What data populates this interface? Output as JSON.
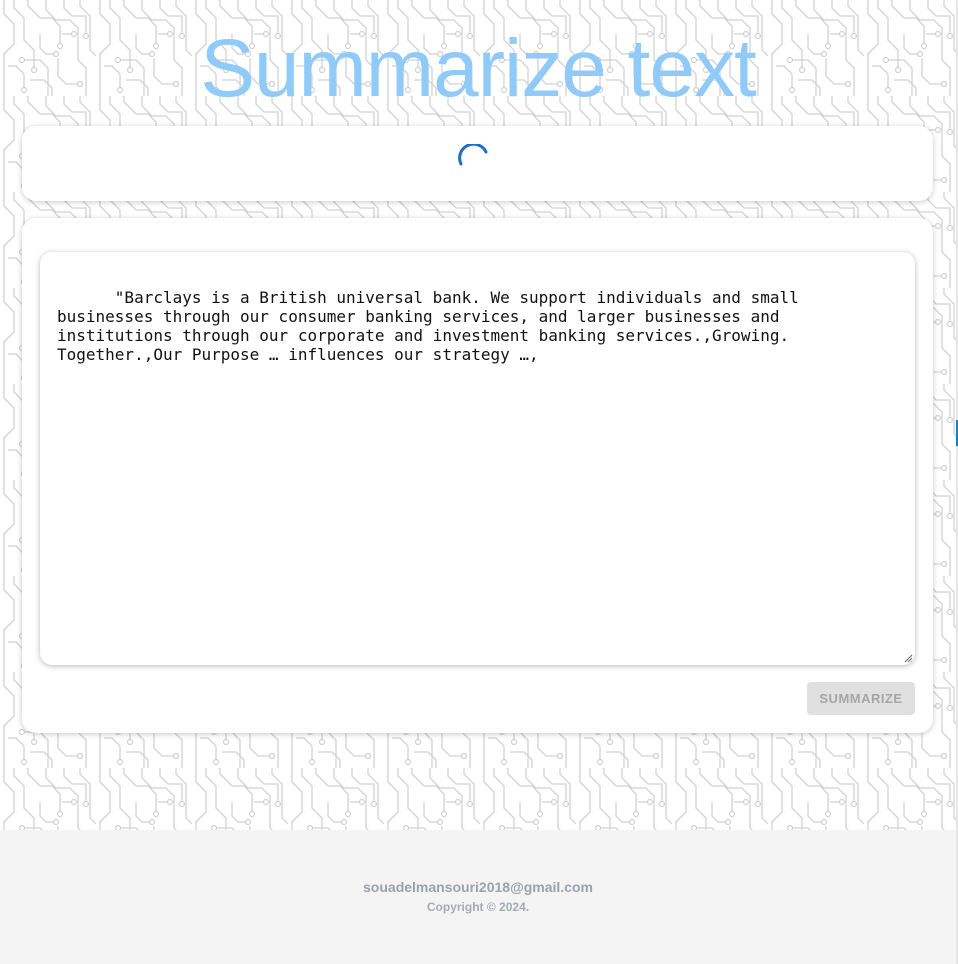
{
  "header": {
    "title": "Summarize text"
  },
  "status": {
    "loading": true
  },
  "editor": {
    "text": "\"Barclays is a British universal bank. We support individuals and small businesses through our consumer banking services, and larger businesses and institutions through our corporate and investment banking services.,Growing. Together.,Our Purpose … influences our strategy …,",
    "summarize_label": "SUMMARIZE"
  },
  "footer": {
    "email": "souadelmansouri2018@gmail.com",
    "copyright": "Copyright © 2024."
  },
  "colors": {
    "title": "#90caf9",
    "spinner": "#1e6fc9",
    "button_bg": "#e0e0e0",
    "button_text": "#a6a6a6",
    "footer_bg": "#f4f4f4"
  },
  "icons": {
    "spinner": "loading-spinner-icon",
    "resize": "resize-grip-icon"
  }
}
